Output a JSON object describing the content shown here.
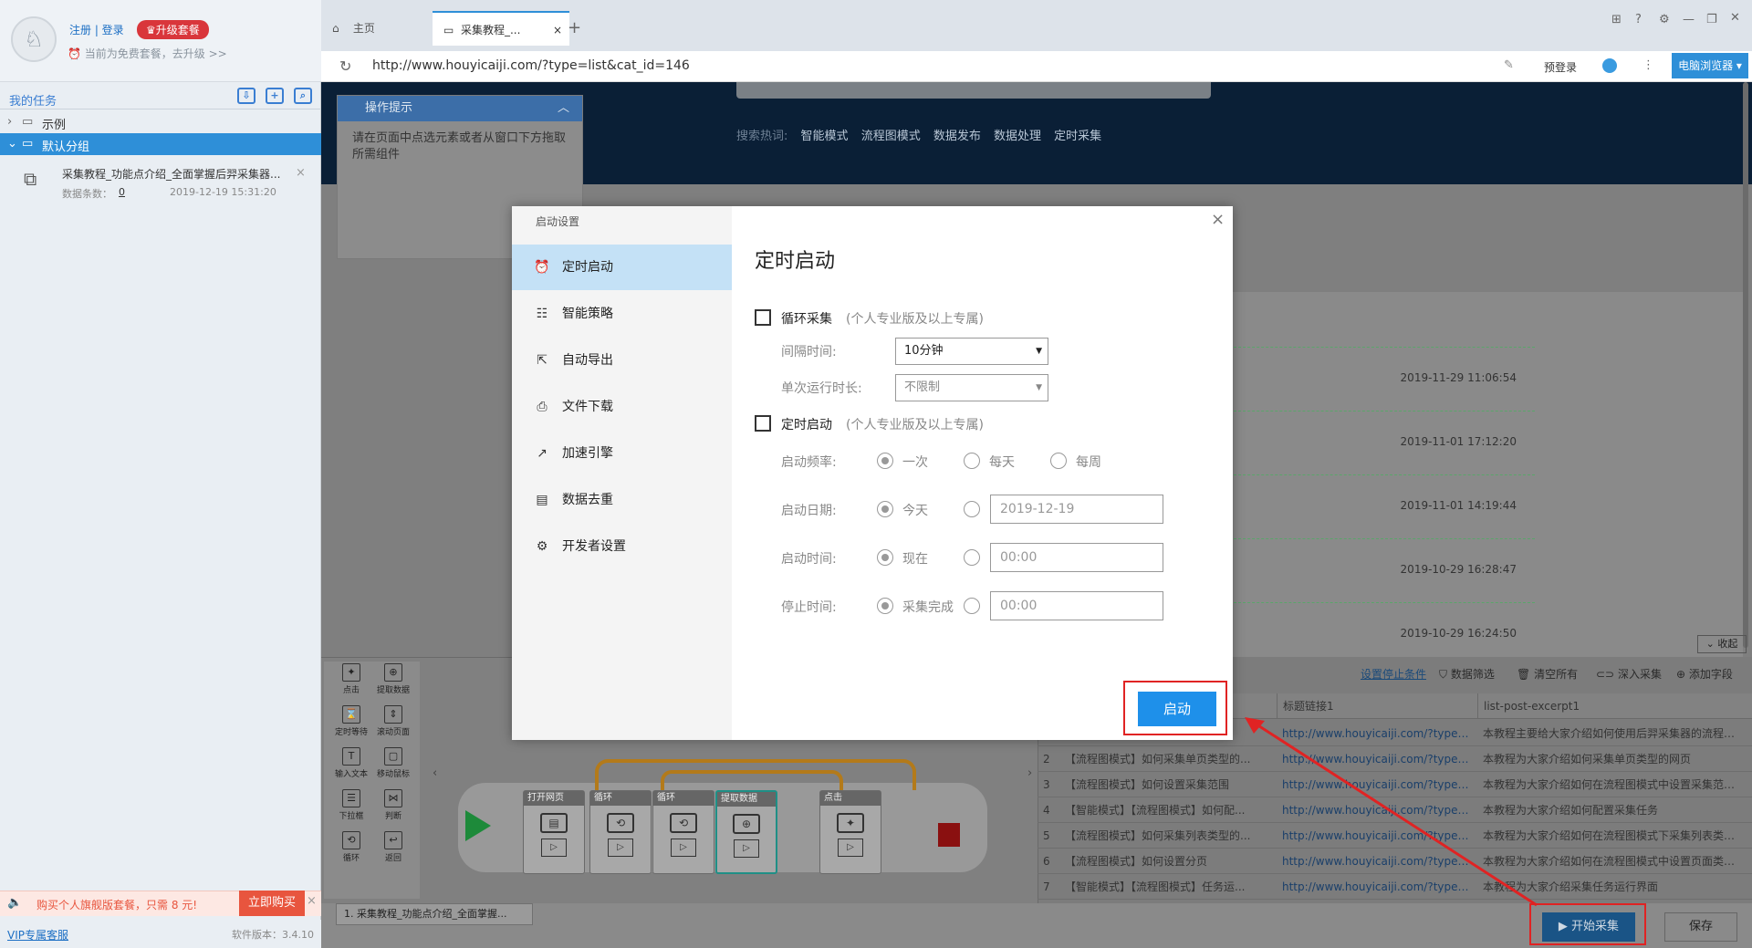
{
  "left_panel": {
    "register_login": "注册 | 登录",
    "upgrade_badge": "♛升级套餐",
    "free_notice": "当前为免费套餐，去升级 >>",
    "my_tasks": "我的任务",
    "tree_example": "示例",
    "tree_default_group": "默认分组",
    "task_name": "采集教程_功能点介绍_全面掌握后羿采集器...",
    "task_count_label": "数据条数：",
    "task_count": "0",
    "task_date": "2019-12-19 15:31:20",
    "ad_text": "购买个人旗舰版套餐，只需 8 元!",
    "ad_button": "立即购买",
    "vip_service": "VIP专属客服",
    "version": "软件版本：3.4.10"
  },
  "browser": {
    "tab_home": "主页",
    "tab_active": "采集教程_...",
    "url": "http://www.houyicaiji.com/?type=list&cat_id=146",
    "prelogin": "预登录",
    "browser_button": "电脑浏览器",
    "hot_label": "搜索热词:",
    "hot_words": [
      "智能模式",
      "流程图模式",
      "数据发布",
      "数据处理",
      "定时采集"
    ]
  },
  "tip": {
    "title": "操作提示",
    "body": "请在页面中点选元素或者从窗口下方拖取所需组件"
  },
  "page_dates": [
    "2019-11-29 11:06:54",
    "2019-11-01 17:12:20",
    "2019-11-01 14:19:44",
    "2019-10-29 16:28:47",
    "2019-10-29 16:24:50"
  ],
  "collapse_label": "收起",
  "palette": [
    "点击",
    "提取数据",
    "定时等待",
    "滚动页面",
    "输入文本",
    "移动鼠标",
    "下拉框",
    "判断",
    "循环",
    "返回"
  ],
  "flow_nodes": [
    "打开网页",
    "循环",
    "循环",
    "提取数据",
    "点击"
  ],
  "grid": {
    "toolbar": [
      "设置停止条件",
      "数据筛选",
      "清空所有",
      "深入采集",
      "添加字段"
    ],
    "headers": [
      "标题链接1",
      "list-post-excerpt1"
    ],
    "rows": [
      {
        "n": "",
        "title": "",
        "link": "http://www.houyicaiji.com/?type=pos...",
        "excerpt": "本教程主要给大家介绍如何使用后羿采集器的流程图..."
      },
      {
        "n": "2",
        "title": "【流程图模式】如何采集单页类型的...",
        "link": "http://www.houyicaiji.com/?type=pos...",
        "excerpt": "本教程为大家介绍如何采集单页类型的网页"
      },
      {
        "n": "3",
        "title": "【流程图模式】如何设置采集范围",
        "link": "http://www.houyicaiji.com/?type=pos...",
        "excerpt": "本教程为大家介绍如何在流程图模式中设置采集范围..."
      },
      {
        "n": "4",
        "title": "【智能模式】【流程图模式】如何配...",
        "link": "http://www.houyicaiji.com/?type=pos...",
        "excerpt": "本教程为大家介绍如何配置采集任务"
      },
      {
        "n": "5",
        "title": "【流程图模式】如何采集列表类型的...",
        "link": "http://www.houyicaiji.com/?type=pos...",
        "excerpt": "本教程为大家介绍如何在流程图模式下采集列表类型..."
      },
      {
        "n": "6",
        "title": "【流程图模式】如何设置分页",
        "link": "http://www.houyicaiji.com/?type=pos...",
        "excerpt": "本教程为大家介绍如何在流程图模式中设置页面类型..."
      },
      {
        "n": "7",
        "title": "【智能模式】【流程图模式】任务运...",
        "link": "http://www.houyicaiji.com/?type=pos...",
        "excerpt": "本教程为大家介绍采集任务运行界面"
      }
    ]
  },
  "status": {
    "task_tab": "1. 采集教程_功能点介绍_全面掌握...",
    "start_button": "▶ 开始采集",
    "save_button": "保存"
  },
  "dialog": {
    "sidebar_title": "启动设置",
    "nav": [
      {
        "label": "定时启动",
        "icon": "⏰"
      },
      {
        "label": "智能策略",
        "icon": "☷"
      },
      {
        "label": "自动导出",
        "icon": "⇱"
      },
      {
        "label": "文件下载",
        "icon": "⎙"
      },
      {
        "label": "加速引擎",
        "icon": "↗"
      },
      {
        "label": "数据去重",
        "icon": "▤"
      },
      {
        "label": "开发者设置",
        "icon": "⚙"
      }
    ],
    "title": "定时启动",
    "loop_label": "循环采集",
    "loop_note": "(个人专业版及以上专属)",
    "interval_label": "间隔时间:",
    "interval_value": "10分钟",
    "single_run_label": "单次运行时长:",
    "single_run_value": "不限制",
    "schedule_label": "定时启动",
    "schedule_note": "(个人专业版及以上专属)",
    "freq_label": "启动频率:",
    "freq_options": [
      "一次",
      "每天",
      "每周"
    ],
    "date_label": "启动日期:",
    "date_option": "今天",
    "date_value": "2019-12-19",
    "time_label": "启动时间:",
    "time_option": "现在",
    "time_value": "00:00",
    "stop_label": "停止时间:",
    "stop_option": "采集完成",
    "stop_value": "00:00",
    "launch_button": "启动"
  }
}
